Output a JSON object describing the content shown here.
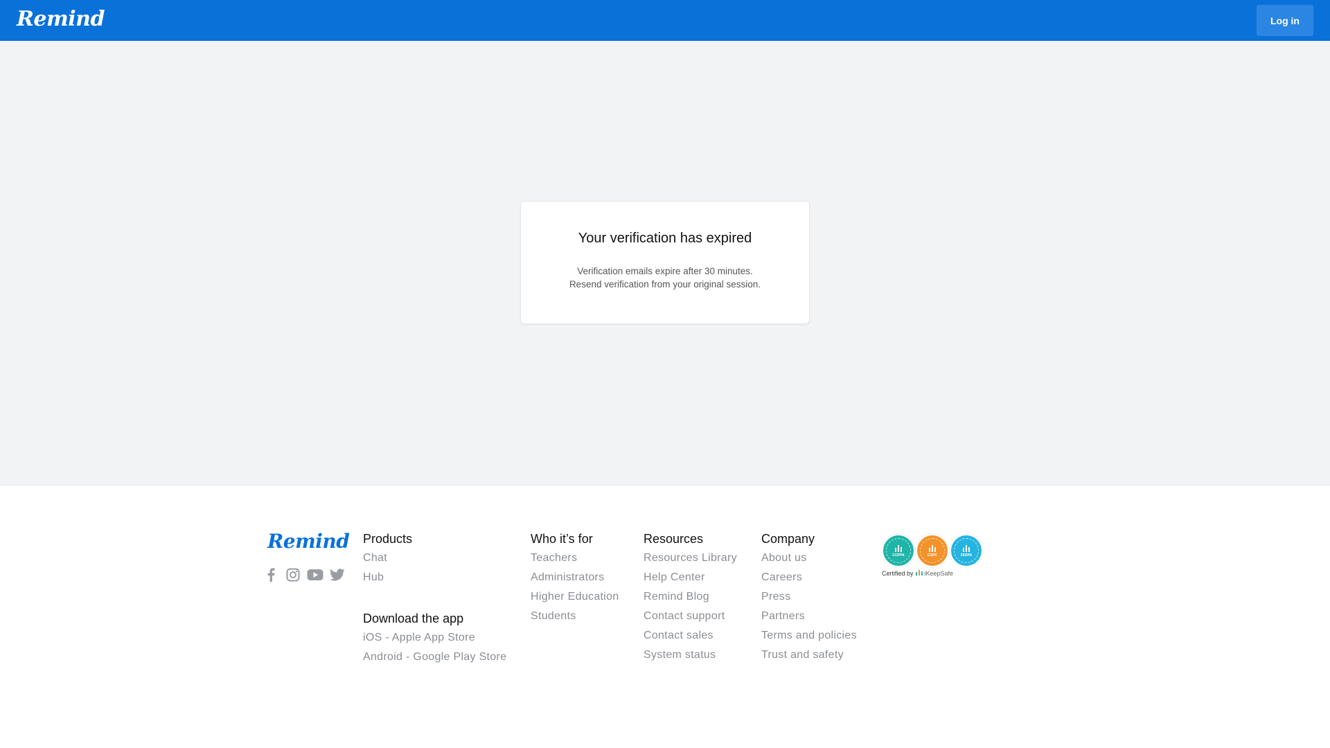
{
  "header": {
    "logo_text": "Remind",
    "login_label": "Log in",
    "brand_color": "#0a71d9"
  },
  "card": {
    "title": "Your verification has expired",
    "line1": "Verification emails expire after 30 minutes.",
    "line2": "Resend verification from your original session."
  },
  "footer": {
    "logo_text": "Remind",
    "socials": [
      "facebook-icon",
      "instagram-icon",
      "youtube-icon",
      "twitter-icon"
    ],
    "products": {
      "heading": "Products",
      "items": [
        "Chat",
        "Hub"
      ]
    },
    "download": {
      "heading": "Download the app",
      "items": [
        "iOS - Apple App Store",
        "Android - Google Play Store"
      ]
    },
    "who": {
      "heading": "Who it’s for",
      "items": [
        "Teachers",
        "Administrators",
        "Higher Education",
        "Students"
      ]
    },
    "resources": {
      "heading": "Resources",
      "items": [
        "Resources Library",
        "Help Center",
        "Remind Blog",
        "Contact support",
        "Contact sales",
        "System status"
      ]
    },
    "company": {
      "heading": "Company",
      "items": [
        "About us",
        "Careers",
        "Press",
        "Partners",
        "Terms and policies",
        "Trust and safety"
      ]
    },
    "badges": {
      "items": [
        {
          "label": "COPPA",
          "color": "#1fb5a8"
        },
        {
          "label": "CSPC",
          "color": "#f2922a"
        },
        {
          "label": "FERPA",
          "color": "#25b4df"
        }
      ],
      "certified_prefix": "Certified by",
      "certifier": "iKeepSafe"
    }
  }
}
